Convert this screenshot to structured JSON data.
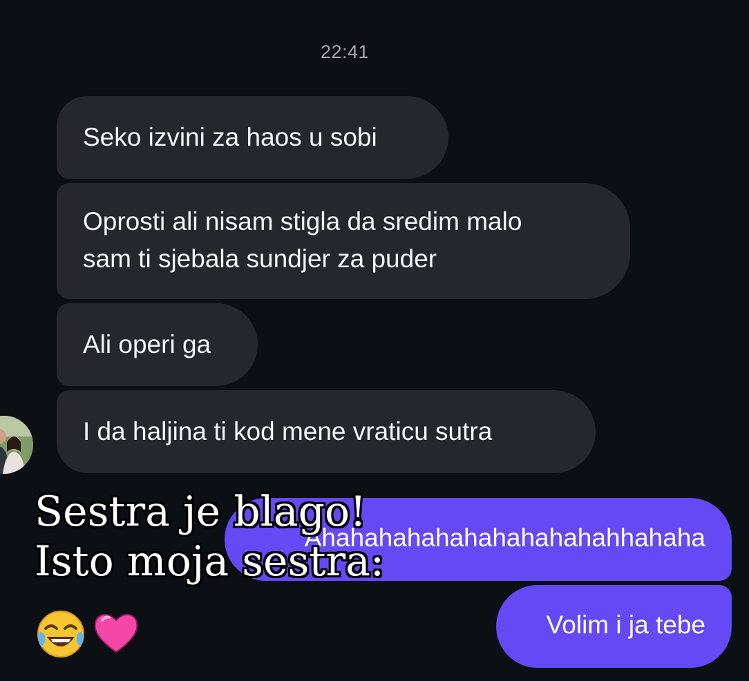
{
  "chat": {
    "timestamp": "22:41",
    "incoming": [
      {
        "text": "Seko izvini za haos u sobi"
      },
      {
        "line1": "Oprosti ali nisam stigla da sredim malo",
        "line2": "sam ti sjebala sundjer za puder"
      },
      {
        "text": "Ali operi ga"
      },
      {
        "text": "I  da haljina ti kod mene vraticu sutra"
      }
    ],
    "outgoing": [
      {
        "text": "Ahahahahahahahahahahahhahaha"
      },
      {
        "text": "Volim i ja tebe"
      }
    ],
    "colors": {
      "background": "#0c0f14",
      "incoming_bubble": "#25272c",
      "outgoing_bubble": "#6449f4",
      "timestamp": "#a6a9b0"
    }
  },
  "overlay": {
    "line1": "Sestra je blago!",
    "line2": "Isto moja sestra:",
    "emojis": [
      "face-with-tears-of-joy-icon",
      "pink-heart-icon"
    ]
  }
}
